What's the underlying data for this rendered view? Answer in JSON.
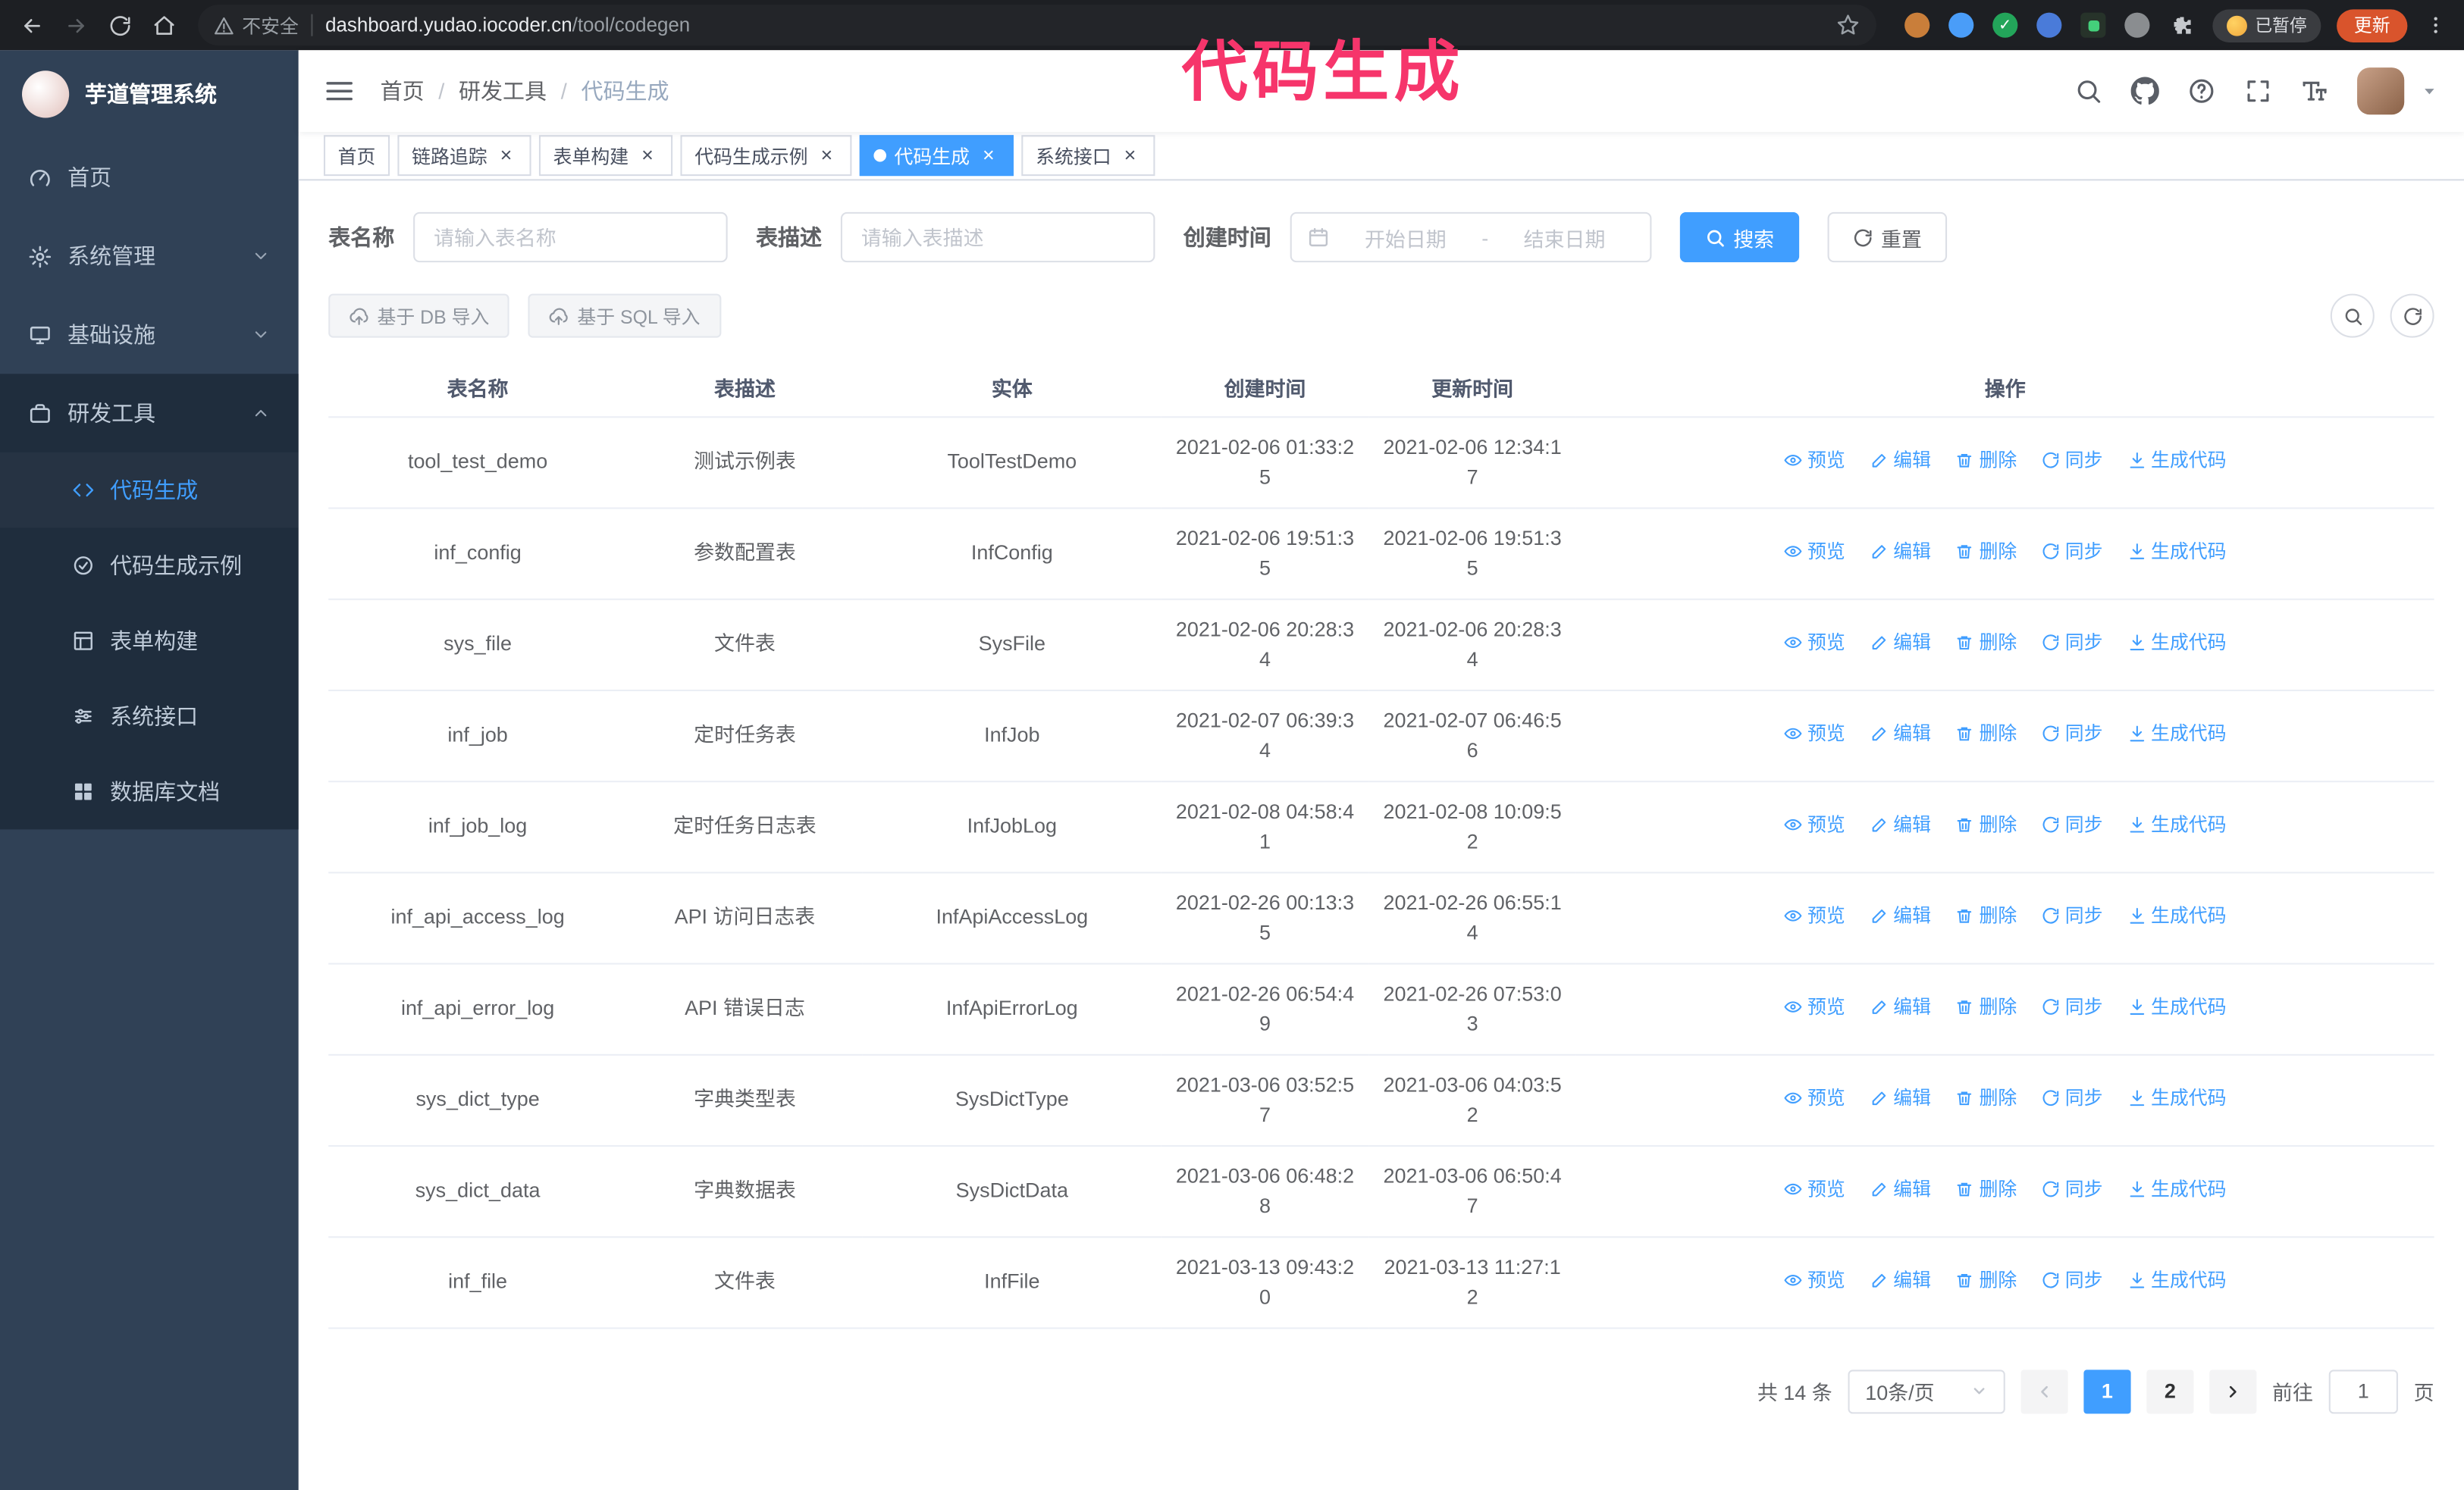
{
  "colors": {
    "accent": "#409EFF",
    "sidebar_bg": "#304156",
    "submenu_bg": "#1F2D3D",
    "tab_active_bg": "#409EFF",
    "update_button_bg": "#D9542C",
    "annotation": "#F6356B"
  },
  "annotation": {
    "text": "代码生成",
    "color": "#F6356B"
  },
  "browser": {
    "security_label": "不安全",
    "url_domain": "dashboard.yudao.iocoder.cn",
    "url_path": "/tool/codegen",
    "paused_badge": "已暂停",
    "update_button": "更新"
  },
  "sidebar": {
    "logo_title": "芋道管理系统",
    "menu": [
      {
        "label": "首页"
      },
      {
        "label": "系统管理"
      },
      {
        "label": "基础设施"
      },
      {
        "label": "研发工具"
      }
    ],
    "submenu": [
      {
        "label": "代码生成"
      },
      {
        "label": "代码生成示例"
      },
      {
        "label": "表单构建"
      },
      {
        "label": "系统接口"
      },
      {
        "label": "数据库文档"
      }
    ]
  },
  "navbar": {
    "breadcrumb": {
      "home": "首页",
      "section": "研发工具",
      "current": "代码生成",
      "separator": "/"
    }
  },
  "tabs": [
    {
      "label": "首页"
    },
    {
      "label": "链路追踪"
    },
    {
      "label": "表单构建"
    },
    {
      "label": "代码生成示例"
    },
    {
      "label": "代码生成"
    },
    {
      "label": "系统接口"
    }
  ],
  "icons": {
    "close": "×"
  },
  "filters": {
    "table_name_label": "表名称",
    "table_name_placeholder": "请输入表名称",
    "table_desc_label": "表描述",
    "table_desc_placeholder": "请输入表描述",
    "create_time_label": "创建时间",
    "date_start_placeholder": "开始日期",
    "date_separator": "-",
    "date_end_placeholder": "结束日期",
    "search_button": "搜索",
    "reset_button": "重置"
  },
  "toolbar": {
    "import_db_button": "基于 DB 导入",
    "import_sql_button": "基于 SQL 导入"
  },
  "table": {
    "columns": [
      "表名称",
      "表描述",
      "实体",
      "创建时间",
      "更新时间",
      "操作"
    ],
    "ops": {
      "preview": "预览",
      "edit": "编辑",
      "delete": "删除",
      "sync": "同步",
      "generate": "生成代码"
    },
    "rows": [
      {
        "name": "tool_test_demo",
        "desc": "测试示例表",
        "entity": "ToolTestDemo",
        "created": "2021-02-06 01:33:25",
        "updated": "2021-02-06 12:34:17"
      },
      {
        "name": "inf_config",
        "desc": "参数配置表",
        "entity": "InfConfig",
        "created": "2021-02-06 19:51:35",
        "updated": "2021-02-06 19:51:35"
      },
      {
        "name": "sys_file",
        "desc": "文件表",
        "entity": "SysFile",
        "created": "2021-02-06 20:28:34",
        "updated": "2021-02-06 20:28:34"
      },
      {
        "name": "inf_job",
        "desc": "定时任务表",
        "entity": "InfJob",
        "created": "2021-02-07 06:39:34",
        "updated": "2021-02-07 06:46:56"
      },
      {
        "name": "inf_job_log",
        "desc": "定时任务日志表",
        "entity": "InfJobLog",
        "created": "2021-02-08 04:58:41",
        "updated": "2021-02-08 10:09:52"
      },
      {
        "name": "inf_api_access_log",
        "desc": "API 访问日志表",
        "entity": "InfApiAccessLog",
        "created": "2021-02-26 00:13:35",
        "updated": "2021-02-26 06:55:14"
      },
      {
        "name": "inf_api_error_log",
        "desc": "API 错误日志",
        "entity": "InfApiErrorLog",
        "created": "2021-02-26 06:54:49",
        "updated": "2021-02-26 07:53:03"
      },
      {
        "name": "sys_dict_type",
        "desc": "字典类型表",
        "entity": "SysDictType",
        "created": "2021-03-06 03:52:57",
        "updated": "2021-03-06 04:03:52"
      },
      {
        "name": "sys_dict_data",
        "desc": "字典数据表",
        "entity": "SysDictData",
        "created": "2021-03-06 06:48:28",
        "updated": "2021-03-06 06:50:47"
      },
      {
        "name": "inf_file",
        "desc": "文件表",
        "entity": "InfFile",
        "created": "2021-03-13 09:43:20",
        "updated": "2021-03-13 11:27:12"
      }
    ]
  },
  "pagination": {
    "total": "共 14 条",
    "page_size": "10条/页",
    "pages": [
      "1",
      "2"
    ],
    "goto_label": "前往",
    "goto_value": "1",
    "page_unit": "页"
  }
}
